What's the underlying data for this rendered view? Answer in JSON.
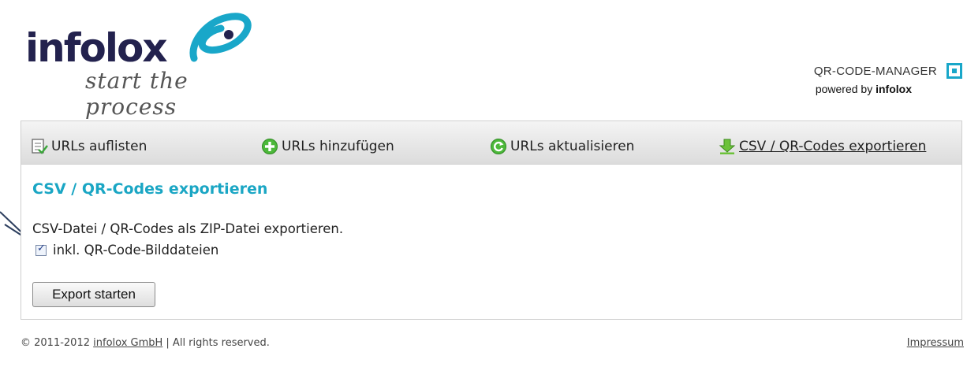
{
  "logo": {
    "wordmark": "infolox",
    "tagline": "start the process"
  },
  "brand": {
    "title": "QR-CODE-MANAGER",
    "powered_by": "powered by",
    "company": "infolox"
  },
  "nav": {
    "items": [
      {
        "label": "URLs auflisten",
        "icon": "list-check-icon"
      },
      {
        "label": "URLs hinzufügen",
        "icon": "add-circle-icon"
      },
      {
        "label": "URLs aktualisieren",
        "icon": "refresh-icon"
      },
      {
        "label": "CSV / QR-Codes exportieren",
        "icon": "download-arrow-icon"
      }
    ]
  },
  "content": {
    "title": "CSV / QR-Codes exportieren",
    "description": "CSV-Datei / QR-Codes als ZIP-Datei exportieren.",
    "checkbox_label": "inkl. QR-Code-Bilddateien",
    "checkbox_checked": true,
    "button_label": "Export starten"
  },
  "footer": {
    "copyright_prefix": "© 2011-2012",
    "company_link": "infolox GmbH",
    "rights": "| All rights reserved.",
    "impressum": "Impressum"
  },
  "colors": {
    "accent": "#1aa6c4",
    "logo_dark": "#23224e"
  }
}
